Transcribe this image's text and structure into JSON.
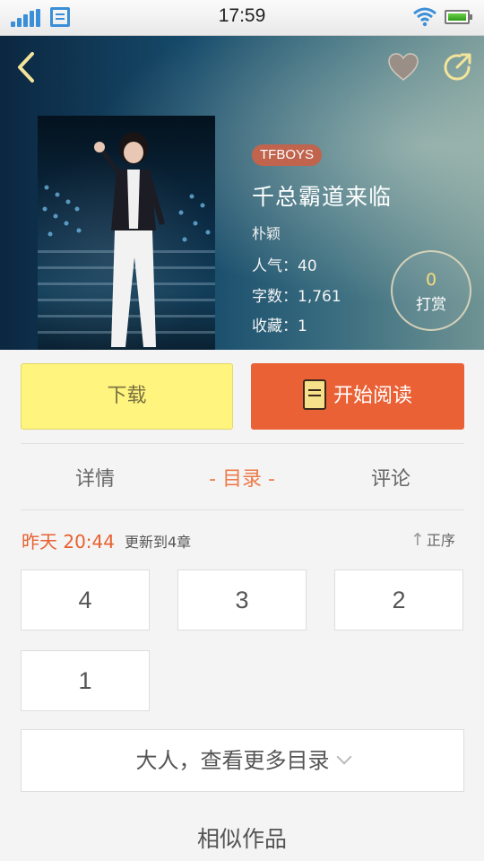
{
  "status_bar": {
    "time": "17:59"
  },
  "book": {
    "tag": "TFBOYS",
    "title": "千总霸道来临",
    "author": "朴颖",
    "popularity": "人气：40",
    "word_count": "字数：1,761",
    "favorites": "收藏：1",
    "reward_count": "0",
    "reward_label": "打赏"
  },
  "actions": {
    "download": "下载",
    "start_reading": "开始阅读"
  },
  "tabs": {
    "details": "详情",
    "toc": "- 目录 -",
    "comments": "评论"
  },
  "update": {
    "time": "昨天 20:44",
    "text": "更新到4章",
    "sort": "正序"
  },
  "chapters": [
    "4",
    "3",
    "2",
    "1"
  ],
  "more_toc": "大人，查看更多目录",
  "similar_heading": "相似作品",
  "colors": {
    "accent": "#ea6136",
    "download_bg": "#fff47e",
    "tab_active": "#ec7a4a"
  }
}
